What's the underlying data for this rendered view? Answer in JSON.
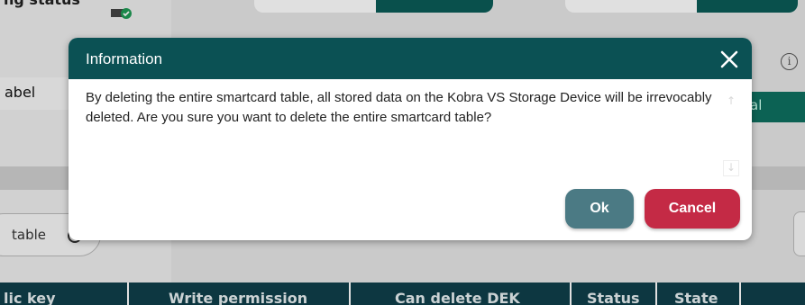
{
  "background": {
    "top_left_text": "ng status",
    "label_text": "abel",
    "green_button_text": "al",
    "table_pill_text": "table",
    "info_icon": "i",
    "table_headers": [
      "lic key",
      "Write permission",
      "Can delete DEK",
      "Status",
      "State"
    ]
  },
  "dialog": {
    "title": "Information",
    "close_icon": "close-icon",
    "message": "By deleting the entire smartcard table, all stored data on the Kobra VS Storage Device will be irrevocably deleted. Are you sure you want to delete the entire smartcard table?",
    "ok_label": "Ok",
    "cancel_label": "Cancel"
  },
  "colors": {
    "header": "#0b5154",
    "ok": "#4b7a84",
    "cancel": "#c42a45",
    "table_header": "#0f3f4a"
  }
}
